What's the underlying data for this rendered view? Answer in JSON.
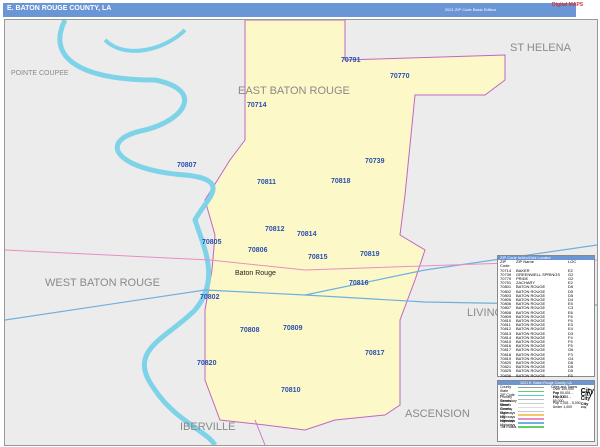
{
  "header": {
    "title": "E. BATON ROUGE COUNTY, LA",
    "edition": "2021 ZIP Code Basic Edition",
    "logo": "Digital MAPS"
  },
  "map": {
    "regions": [
      "EAST BATON ROUGE",
      "WEST BATON ROUGE",
      "ST HELENA",
      "POINTE COUPEE",
      "LIVINGSTON",
      "ASCENSION",
      "IBERVILLE"
    ],
    "city": "Baton Rouge",
    "zips": [
      {
        "z": "70791"
      },
      {
        "z": "70770"
      },
      {
        "z": "70714"
      },
      {
        "z": "70807"
      },
      {
        "z": "70811"
      },
      {
        "z": "70818"
      },
      {
        "z": "70739"
      },
      {
        "z": "70812"
      },
      {
        "z": "70814"
      },
      {
        "z": "70805"
      },
      {
        "z": "70806"
      },
      {
        "z": "70815"
      },
      {
        "z": "70819"
      },
      {
        "z": "70816"
      },
      {
        "z": "70802"
      },
      {
        "z": "70808"
      },
      {
        "z": "70809"
      },
      {
        "z": "70817"
      },
      {
        "z": "70820"
      },
      {
        "z": "70810"
      }
    ],
    "colors": {
      "county": "#fdf8c8",
      "outside": "#ececec",
      "water": "#7fd3e8",
      "zip_label": "#2a4fb0",
      "header": "#6b96d6"
    }
  },
  "zip_table": {
    "title": "ZIP Code Index/Grid Locator",
    "headers": [
      "ZIP Code",
      "ZIP Name",
      "LOC"
    ],
    "rows": [
      [
        "70714",
        "BAKER",
        "E2"
      ],
      [
        "70739",
        "GREENWELL SPRINGS",
        "G2"
      ],
      [
        "70770",
        "PRIDE",
        "G2"
      ],
      [
        "70791",
        "ZACHARY",
        "E2"
      ],
      [
        "70801",
        "BATON ROUGE",
        "D5"
      ],
      [
        "70802",
        "BATON ROUGE",
        "D5"
      ],
      [
        "70803",
        "BATON ROUGE",
        "D5"
      ],
      [
        "70805",
        "BATON ROUGE",
        "D4"
      ],
      [
        "70806",
        "BATON ROUGE",
        "E5"
      ],
      [
        "70807",
        "BATON ROUGE",
        "C3"
      ],
      [
        "70808",
        "BATON ROUGE",
        "E6"
      ],
      [
        "70809",
        "BATON ROUGE",
        "F6"
      ],
      [
        "70810",
        "BATON ROUGE",
        "F6"
      ],
      [
        "70811",
        "BATON ROUGE",
        "E3"
      ],
      [
        "70812",
        "BATON ROUGE",
        "E4"
      ],
      [
        "70813",
        "BATON ROUGE",
        "D3"
      ],
      [
        "70814",
        "BATON ROUGE",
        "F4"
      ],
      [
        "70815",
        "BATON ROUGE",
        "F5"
      ],
      [
        "70816",
        "BATON ROUGE",
        "F5"
      ],
      [
        "70817",
        "BATON ROUGE",
        "G6"
      ],
      [
        "70818",
        "BATON ROUGE",
        "F3"
      ],
      [
        "70819",
        "BATON ROUGE",
        "G4"
      ],
      [
        "70820",
        "BATON ROUGE",
        "D6"
      ],
      [
        "70821",
        "BATON ROUGE",
        "D5"
      ],
      [
        "70825",
        "BATON ROUGE",
        "D5"
      ],
      [
        "70836",
        "BATON ROUGE",
        "F5"
      ]
    ]
  },
  "legend": {
    "title": "2021 E. Baton Rouge County, LA",
    "items": [
      "County",
      "State",
      "ZIP Code",
      "Primary Streets",
      "Secondary Streets",
      "Minor Streets",
      "Country Highways",
      "State Highways",
      "US Highways",
      "Interstate Highways",
      "Toll Roads"
    ],
    "item_colors": [
      "#999999",
      "#66cc66",
      "#55cccc",
      "#bbbbbb",
      "#cccccc",
      "#dddddd",
      "#cccccc",
      "#f5c66b",
      "#e88fc0",
      "#6fb0e0",
      "#66cc66"
    ],
    "towns_title": "Cities and Towns",
    "towns": [
      "Over 100,000 Pop",
      "Pop 50,001 - 100,000",
      "Pop 5,001 - 50,000",
      "Pop 1,001 - 5,000",
      "Under 1,000"
    ],
    "town_samples": [
      "City",
      "City",
      "City",
      "City",
      "City"
    ]
  }
}
